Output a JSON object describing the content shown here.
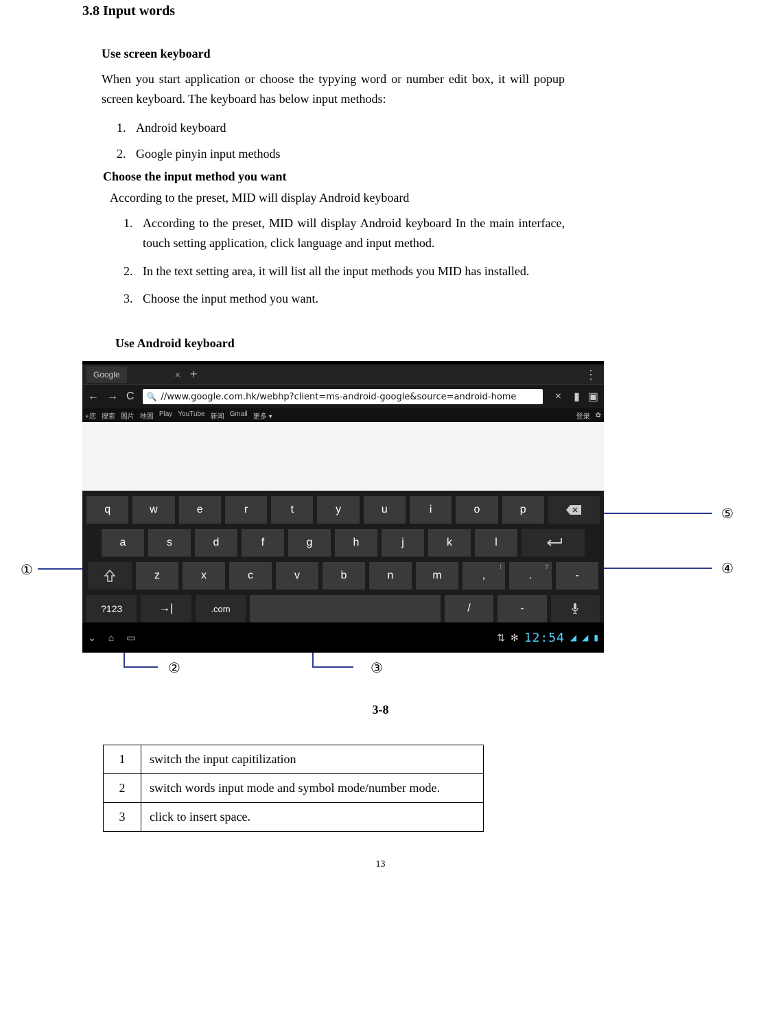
{
  "section_title": "3.8 Input words",
  "h1": "Use screen keyboard",
  "p1": "When you start application or choose the typying word or number edit box, it will popup screen keyboard. The keyboard has below input methods:",
  "list1": [
    "Android keyboard",
    "Google pinyin input methods"
  ],
  "h2": "Choose the input method you want",
  "p2": "According to the preset, MID will display Android keyboard",
  "list2": [
    "According to the preset, MID will display Android keyboard In the main interface, touch setting application, click language and input method.",
    "In the text setting area, it will list all the input methods you MID has installed.",
    "Choose the input method you want."
  ],
  "h3": "Use Android keyboard",
  "callouts": {
    "c1": "①",
    "c2": "②",
    "c3": "③",
    "c4": "④",
    "c5": "⑤"
  },
  "shot": {
    "tab_label": "Google",
    "url": "//www.google.com.hk/webhp?client=ms-android-google&source=android-home",
    "cn_left": [
      "+您",
      "搜索",
      "图片",
      "地图",
      "Play",
      "YouTube",
      "新闻",
      "Gmail",
      "更多 ▾"
    ],
    "cn_right_login": "登录",
    "row1": [
      "q",
      "w",
      "e",
      "r",
      "t",
      "y",
      "u",
      "i",
      "o",
      "p"
    ],
    "row2": [
      "a",
      "s",
      "d",
      "f",
      "g",
      "h",
      "j",
      "k",
      "l"
    ],
    "row3": [
      "z",
      "x",
      "c",
      "v",
      "b",
      "n",
      "m",
      ",",
      "."
    ],
    "row3_dash": "-",
    "mode_label": "?123",
    "com_label": ".com",
    "slash": "/",
    "dash": "-",
    "clock": "12:54",
    "comma_sup": "!",
    "period_sup": "?"
  },
  "figure_caption": "3-8",
  "legend": [
    {
      "n": "1",
      "t": "switch the input capitilization"
    },
    {
      "n": "2",
      "t": "switch words input mode and symbol mode/number mode."
    },
    {
      "n": "3",
      "t": "click to insert space."
    }
  ],
  "page_number": "13"
}
